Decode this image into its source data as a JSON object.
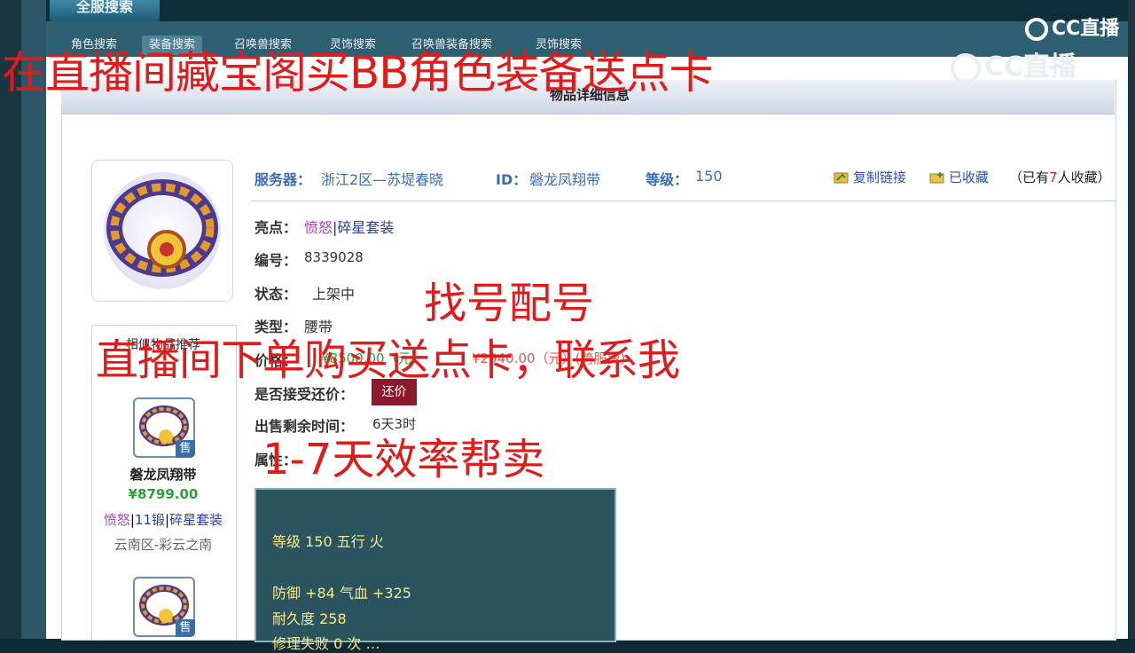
{
  "nav": {
    "top_tab": "全服搜索",
    "subtabs": [
      "角色搜索",
      "装备搜索",
      "召唤兽搜索",
      "灵饰搜索",
      "召唤兽装备搜索",
      "灵饰搜索"
    ]
  },
  "panel": {
    "title": "物品详细信息"
  },
  "item": {
    "server_label": "服务器：",
    "server": "浙江2区—苏堤春晓",
    "id_label": "ID：",
    "id": "磐龙凤翔带",
    "level_label": "等级：",
    "level": "150",
    "copy_link": "复制链接",
    "favorited": "已收藏",
    "fav_count_prefix": "（已有",
    "fav_count": "7",
    "fav_count_suffix": "人收藏）",
    "highlight_label": "亮点：",
    "highlight_1": "愤怒",
    "highlight_sep": "|",
    "highlight_2": "碎星套装",
    "number_label": "编号：",
    "number": "8339028",
    "status_label": "状态：",
    "status": "上架中",
    "type_label": "类型：",
    "type": "腰带",
    "price_label": "价格：",
    "price_main": "¥8500.00（元）",
    "price_cross": "¥2940.00（元）(跨服费)",
    "accept_bargain_label": "是否接受还价：",
    "bargain_button": "还价",
    "remaining_label": "出售剩余时间：",
    "remaining": "6天3时",
    "attr_label": "属性："
  },
  "attributes": {
    "line1": "等级 150 五行 火",
    "line2": "防御 +84 气血 +325",
    "line3": "耐久度 258",
    "line4": "修理失败 0 次 …"
  },
  "sidebar": {
    "heading": "相似物品推荐",
    "items": [
      {
        "badge": "售",
        "name": "磐龙凤翔带",
        "price": "¥8799.00",
        "tag1": "愤怒",
        "tag2": "11锻",
        "tag3": "碎星套装",
        "server": "云南区-彩云之南"
      },
      {
        "badge": "售"
      }
    ]
  },
  "overlays": {
    "top": "在直播间藏宝阁买BB角色装备送点卡",
    "find": "找号配号",
    "live": "直播间下单购买送点卡，联系我",
    "days": "1-7天效率帮卖"
  },
  "watermark": {
    "logo1": "CC直播",
    "logo2": "CC直播"
  },
  "colors": {
    "accent_red": "#e01b1b",
    "link_blue": "#3d6bb3",
    "purple": "#b040c8",
    "price_green": "#2aa039",
    "bargain_bg": "#8b1a2c"
  }
}
